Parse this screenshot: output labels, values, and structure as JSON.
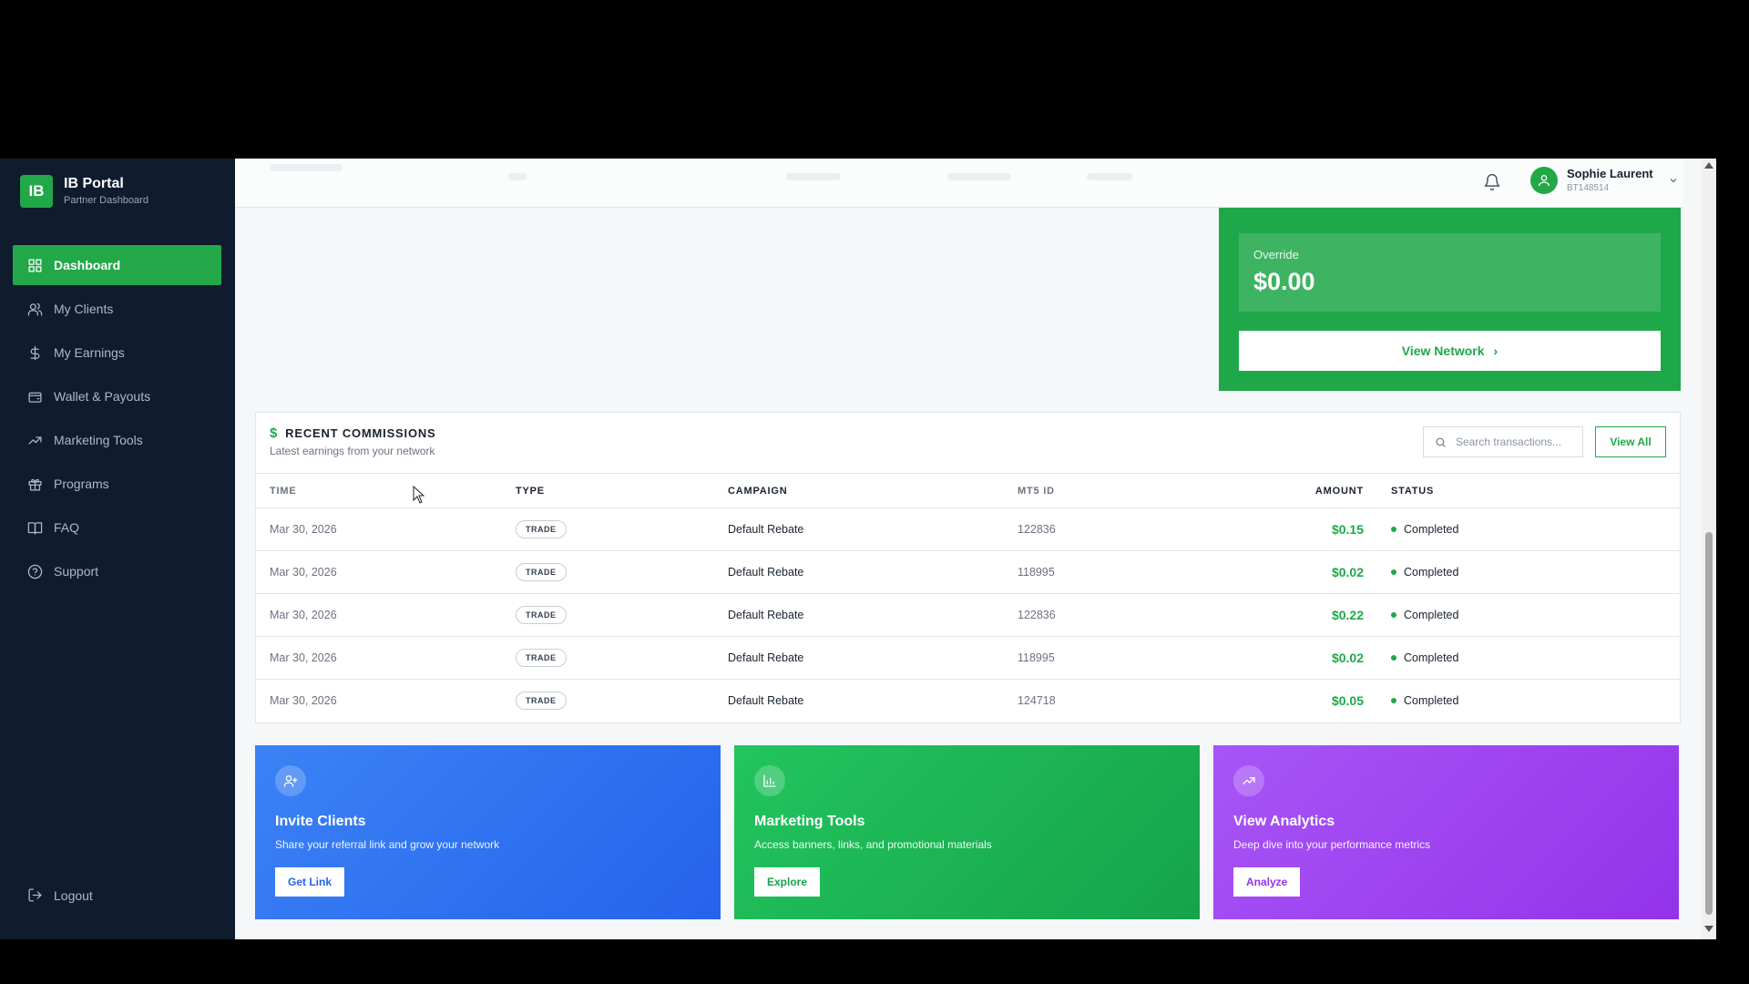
{
  "app": {
    "logo": "IB",
    "title": "IB Portal",
    "subtitle": "Partner Dashboard"
  },
  "sidebar": {
    "items": [
      {
        "label": "Dashboard",
        "icon": "grid-icon",
        "active": true
      },
      {
        "label": "My Clients",
        "icon": "users-icon"
      },
      {
        "label": "My Earnings",
        "icon": "dollar-icon"
      },
      {
        "label": "Wallet & Payouts",
        "icon": "wallet-icon"
      },
      {
        "label": "Marketing Tools",
        "icon": "trending-up-icon"
      },
      {
        "label": "Programs",
        "icon": "gift-icon"
      },
      {
        "label": "FAQ",
        "icon": "book-icon"
      },
      {
        "label": "Support",
        "icon": "help-circle-icon"
      }
    ],
    "logout": "Logout"
  },
  "header": {
    "user_name": "Sophie Laurent",
    "user_id": "BT148514"
  },
  "network_card": {
    "override_label": "Override",
    "override_value": "$0.00",
    "view_network": "View Network"
  },
  "commissions": {
    "title": "RECENT COMMISSIONS",
    "subtitle": "Latest earnings from your network",
    "search_placeholder": "Search transactions...",
    "view_all": "View All",
    "columns": {
      "time": "TIME",
      "type": "TYPE",
      "campaign": "CAMPAIGN",
      "mt5": "MT5 ID",
      "amount": "AMOUNT",
      "status": "STATUS"
    },
    "rows": [
      {
        "time": "Mar 30, 2026",
        "type": "TRADE",
        "campaign": "Default Rebate",
        "mt5": "122836",
        "amount": "$0.15",
        "status": "Completed"
      },
      {
        "time": "Mar 30, 2026",
        "type": "TRADE",
        "campaign": "Default Rebate",
        "mt5": "118995",
        "amount": "$0.02",
        "status": "Completed"
      },
      {
        "time": "Mar 30, 2026",
        "type": "TRADE",
        "campaign": "Default Rebate",
        "mt5": "122836",
        "amount": "$0.22",
        "status": "Completed"
      },
      {
        "time": "Mar 30, 2026",
        "type": "TRADE",
        "campaign": "Default Rebate",
        "mt5": "118995",
        "amount": "$0.02",
        "status": "Completed"
      },
      {
        "time": "Mar 30, 2026",
        "type": "TRADE",
        "campaign": "Default Rebate",
        "mt5": "124718",
        "amount": "$0.05",
        "status": "Completed"
      }
    ]
  },
  "actions": {
    "invite": {
      "title": "Invite Clients",
      "desc": "Share your referral link and grow your network",
      "button": "Get Link"
    },
    "marketing": {
      "title": "Marketing Tools",
      "desc": "Access banners, links, and promotional materials",
      "button": "Explore"
    },
    "analytics": {
      "title": "View Analytics",
      "desc": "Deep dive into your performance metrics",
      "button": "Analyze"
    }
  },
  "colors": {
    "brand": "#22a849",
    "sidebar": "#0f1c2e",
    "blue": "#2563eb",
    "purple": "#9333ea"
  }
}
